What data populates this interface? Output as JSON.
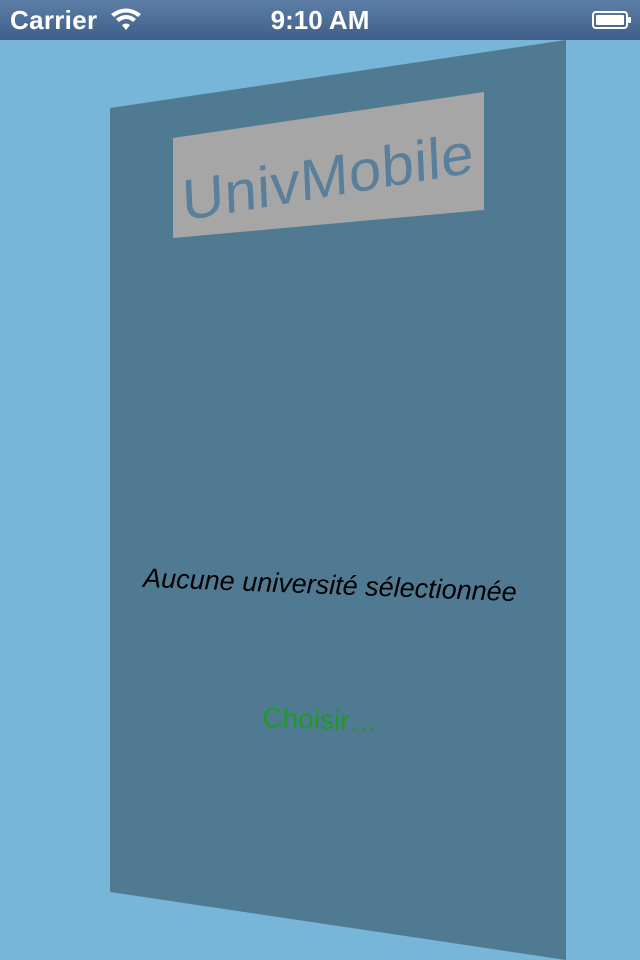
{
  "status_bar": {
    "carrier": "Carrier",
    "time": "9:10 AM",
    "wifi_icon": "wifi-icon",
    "battery_icon": "battery-icon"
  },
  "card": {
    "logo_text": "UnivMobile",
    "message": "Aucune université sélectionnée",
    "choose_label": "Choisir…"
  },
  "colors": {
    "background": "#78b6d9",
    "card": "#507a92",
    "logo_box": "#a6a6a6",
    "logo_text": "#5a7f9b",
    "choose_button": "#1f9a28",
    "status_bar": "#4a6a94"
  }
}
